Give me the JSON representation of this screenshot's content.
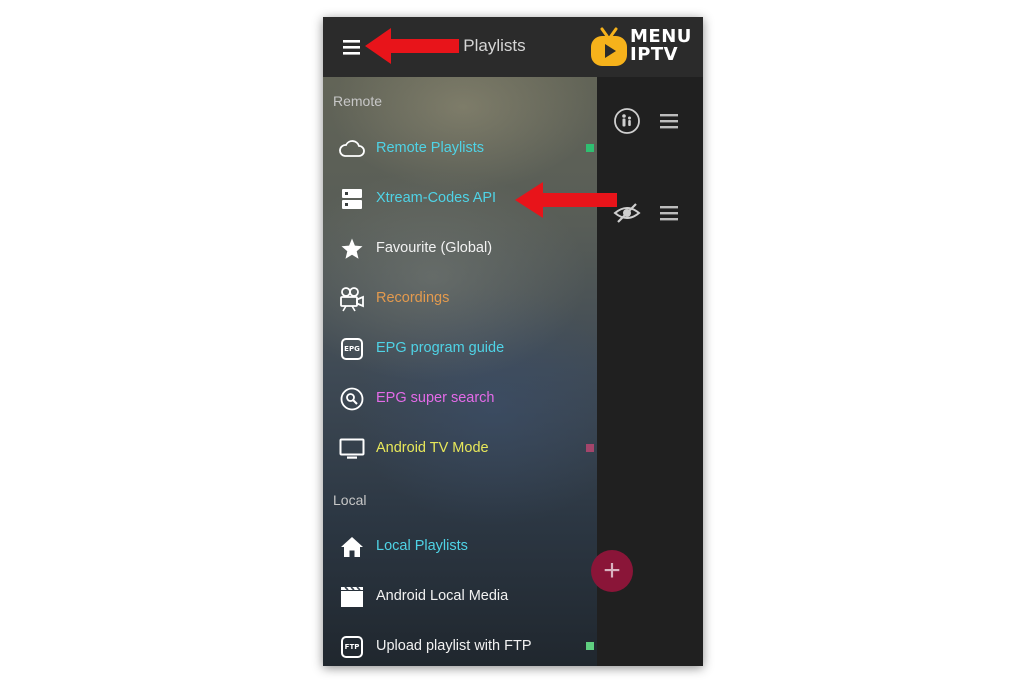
{
  "topbar": {
    "title": "Remote Playlists"
  },
  "logo": {
    "line1": "MENU",
    "line2": "IPTV",
    "accent_color": "#f6b21b"
  },
  "drawer": {
    "sections": {
      "remote": "Remote",
      "local": "Local"
    },
    "items": [
      {
        "label": "Remote Playlists",
        "icon": "cloud-icon",
        "color": "#4fd3e6",
        "status_color": "#2fbf71"
      },
      {
        "label": "Xtream-Codes API",
        "icon": "server-icon",
        "color": "#4fd3e6"
      },
      {
        "label": "Favourite (Global)",
        "icon": "star-icon",
        "color": "#f2f2f2"
      },
      {
        "label": "Recordings",
        "icon": "video-camera-icon",
        "color": "#e39a4e"
      },
      {
        "label": "EPG program guide",
        "icon": "epg-icon",
        "icon_text": "EPG",
        "color": "#4fd3e6"
      },
      {
        "label": "EPG super search",
        "icon": "search-icon",
        "color": "#e46be8"
      },
      {
        "label": "Android TV Mode",
        "icon": "tv-icon",
        "color": "#e8e85a",
        "status_color": "#a4456b"
      },
      {
        "label": "Local Playlists",
        "icon": "home-icon",
        "color": "#4fd3e6"
      },
      {
        "label": "Android Local Media",
        "icon": "film-icon",
        "color": "#f2f2f2"
      },
      {
        "label": "Upload playlist with FTP",
        "icon": "ftp-icon",
        "icon_text": "FTP",
        "color": "#f2f2f2",
        "status_color": "#5fcf80"
      }
    ]
  },
  "right_pane": {
    "row1_icon": "parental-icon",
    "row2_icon": "eye-off-icon"
  },
  "fab": {
    "symbol": "+",
    "color": "#8a1538"
  },
  "annotations": {
    "arrow_color": "#e8141a"
  }
}
